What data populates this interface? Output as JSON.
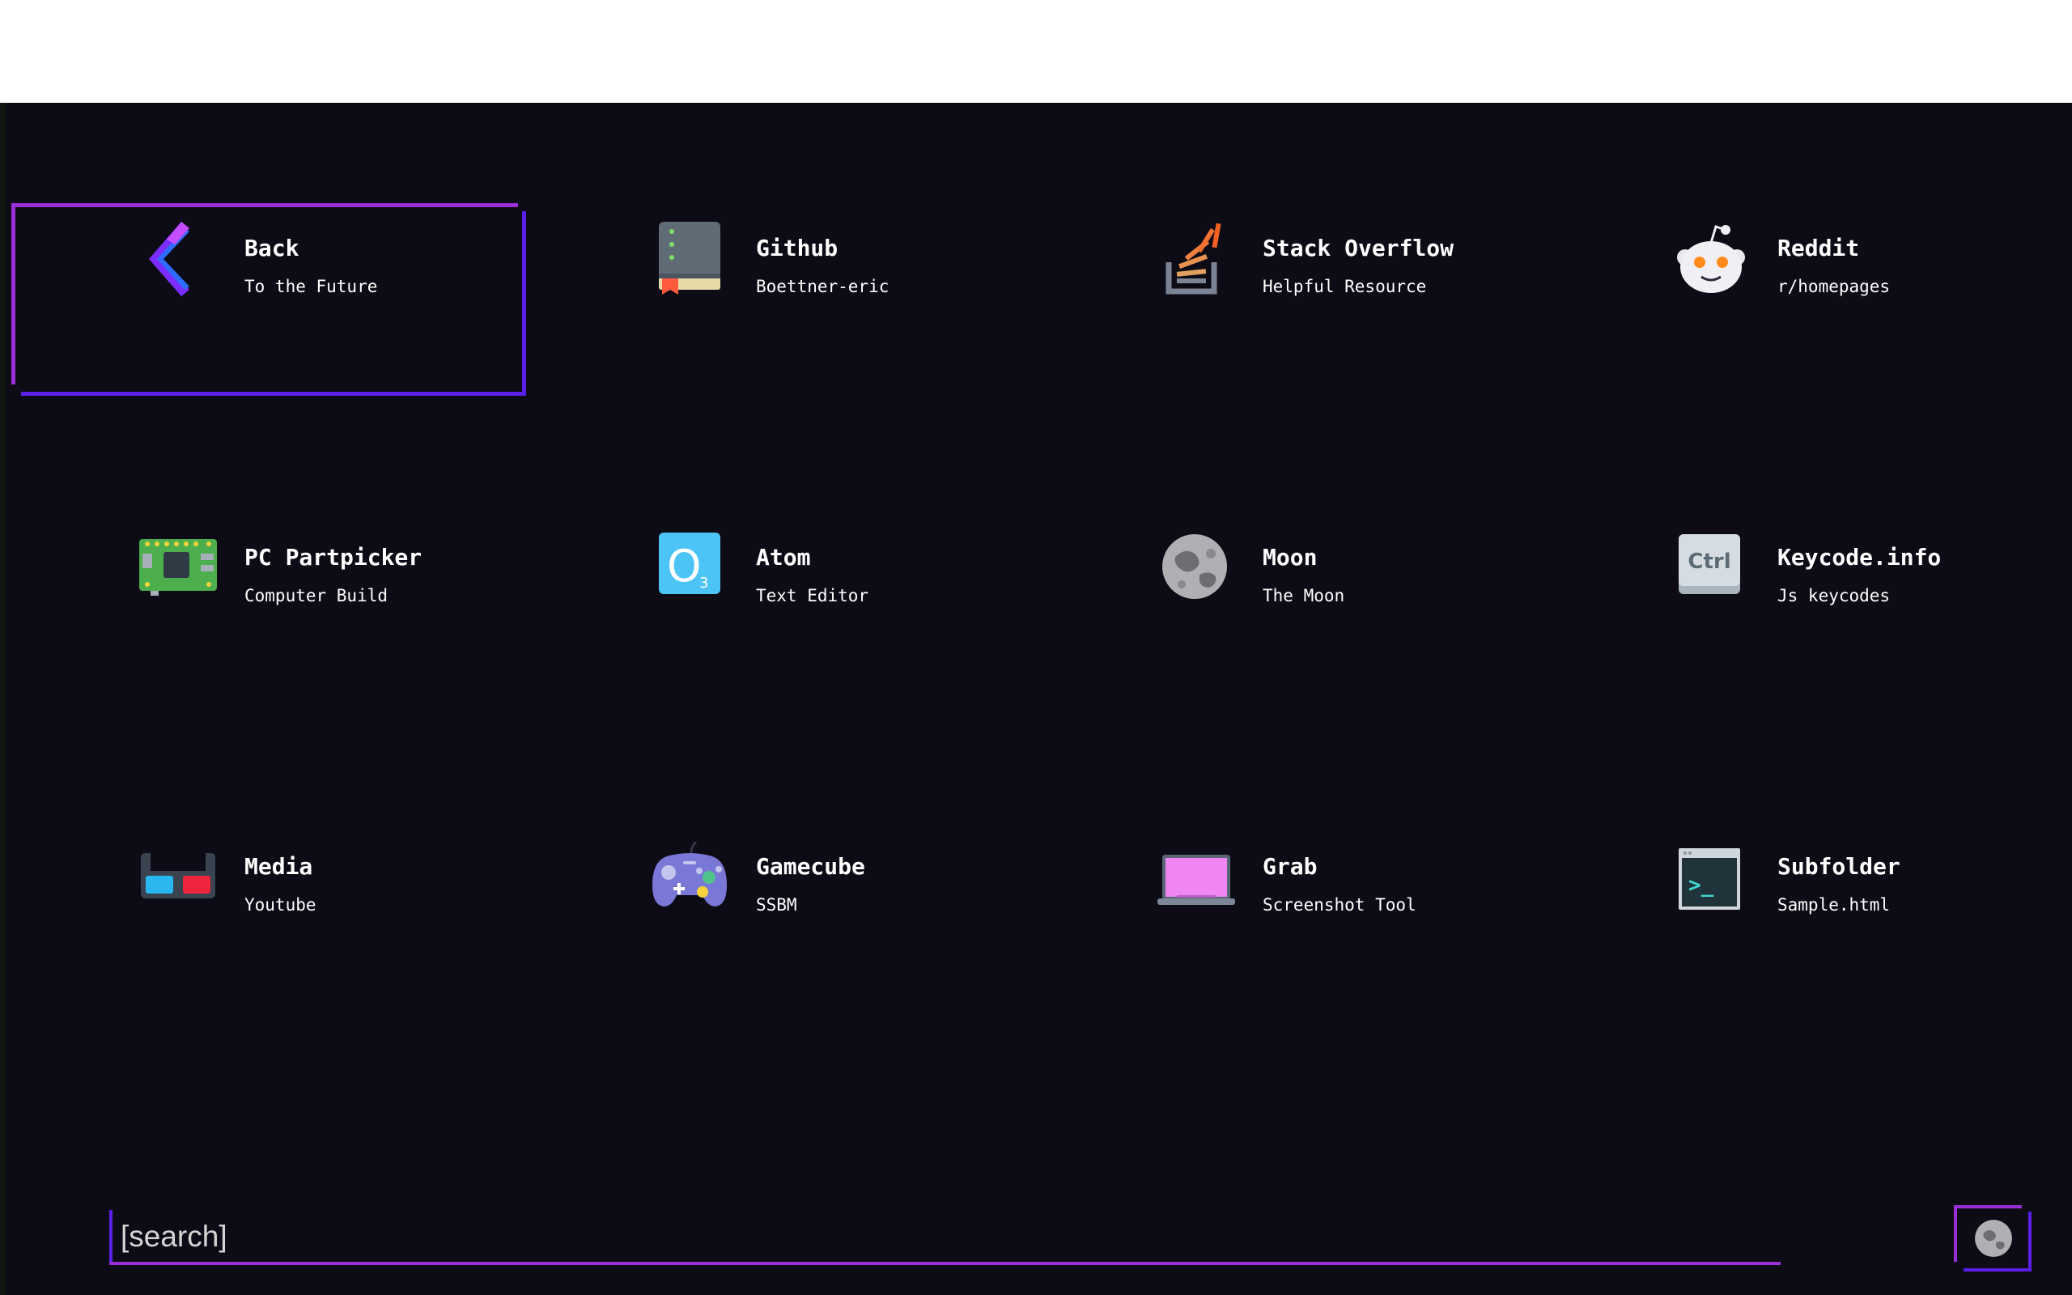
{
  "tiles": [
    {
      "title": "Back",
      "subtitle": "To the Future",
      "icon": "back-chevron-icon"
    },
    {
      "title": "Github",
      "subtitle": "Boettner-eric",
      "icon": "book-icon"
    },
    {
      "title": "Stack Overflow",
      "subtitle": "Helpful Resource",
      "icon": "stackoverflow-icon"
    },
    {
      "title": "Reddit",
      "subtitle": "r/homepages",
      "icon": "reddit-icon"
    },
    {
      "title": "PC Partpicker",
      "subtitle": "Computer Build",
      "icon": "circuit-board-icon"
    },
    {
      "title": "Atom",
      "subtitle": "Text Editor",
      "icon": "ozone-icon"
    },
    {
      "title": "Moon",
      "subtitle": "The Moon",
      "icon": "moon-icon"
    },
    {
      "title": "Keycode.info",
      "subtitle": "Js keycodes",
      "icon": "ctrl-key-icon"
    },
    {
      "title": "Media",
      "subtitle": "Youtube",
      "icon": "3d-glasses-icon"
    },
    {
      "title": "Gamecube",
      "subtitle": "SSBM",
      "icon": "gamepad-icon"
    },
    {
      "title": "Grab",
      "subtitle": "Screenshot Tool",
      "icon": "laptop-icon"
    },
    {
      "title": "Subfolder",
      "subtitle": "Sample.html",
      "icon": "terminal-icon"
    }
  ],
  "icon_labels": {
    "ozone_letter": "O",
    "ozone_sub": "3",
    "ctrl": "Ctrl",
    "terminal_prompt": ">_"
  },
  "search": {
    "placeholder": "[search]",
    "value": ""
  },
  "theme": {
    "background": "#0d0b15",
    "accent_purple": "#9a2fd8",
    "accent_blue": "#5a1fe8"
  }
}
